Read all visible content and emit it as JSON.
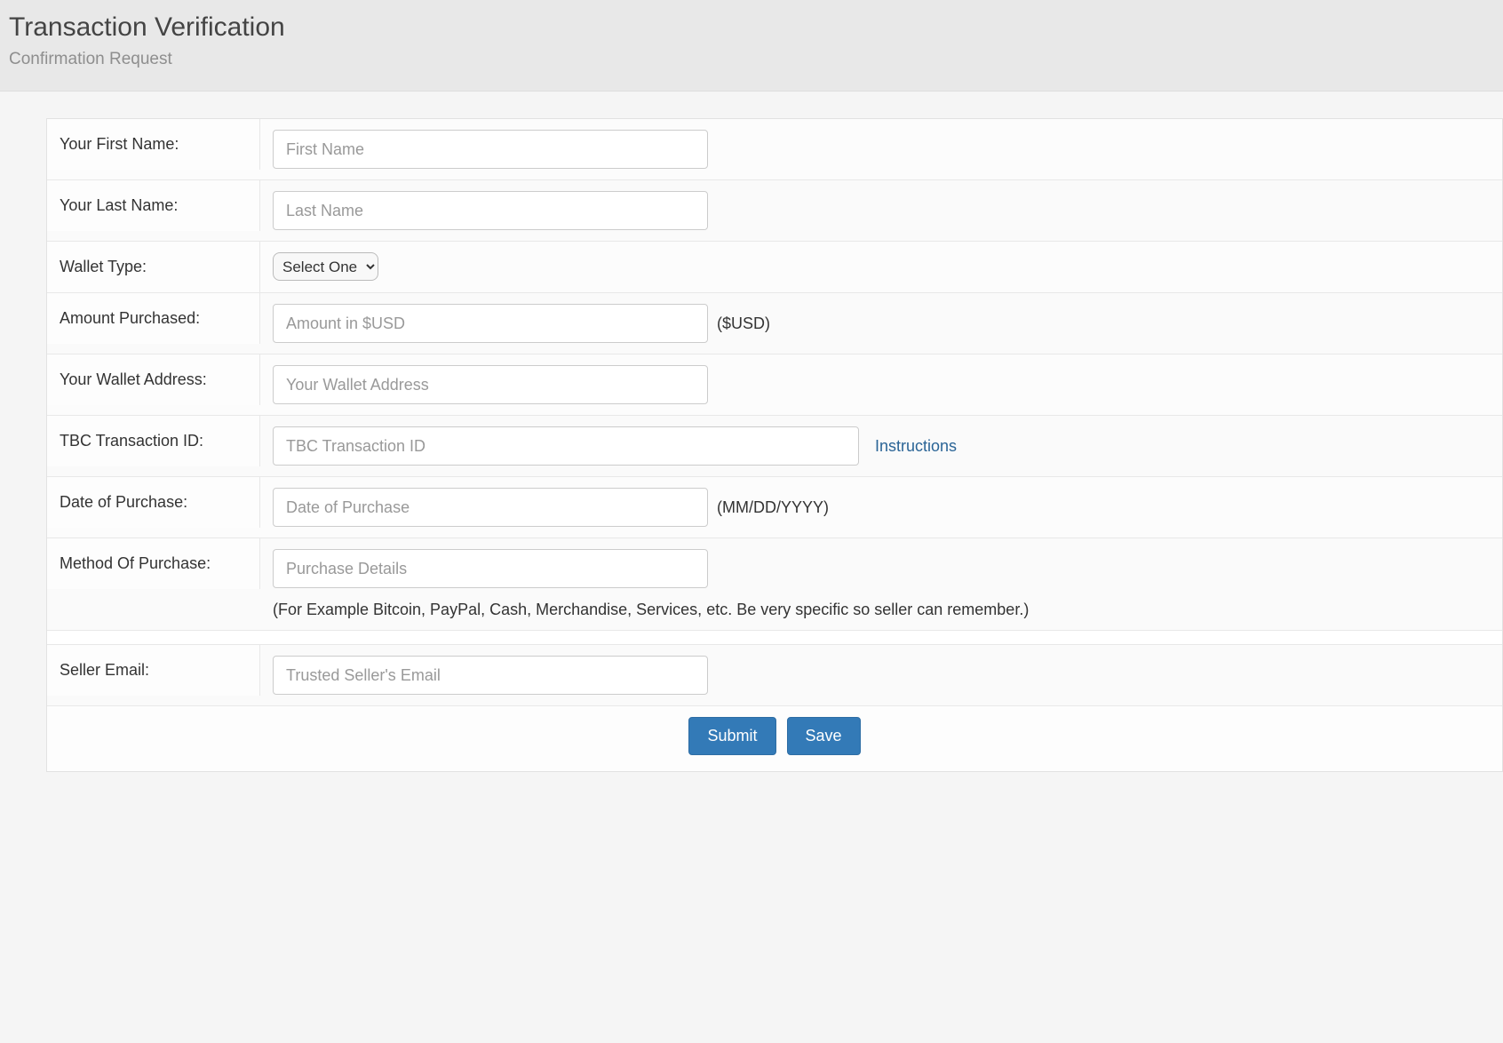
{
  "header": {
    "title": "Transaction Verification",
    "subtitle": "Confirmation Request"
  },
  "form": {
    "first_name": {
      "label": "Your First Name:",
      "placeholder": "First Name",
      "value": ""
    },
    "last_name": {
      "label": "Your Last Name:",
      "placeholder": "Last Name",
      "value": ""
    },
    "wallet_type": {
      "label": "Wallet Type:",
      "selected": "Select One",
      "options": [
        "Select One"
      ]
    },
    "amount_purchased": {
      "label": "Amount Purchased:",
      "placeholder": "Amount in $USD",
      "value": "",
      "suffix": "($USD)"
    },
    "wallet_address": {
      "label": "Your Wallet Address:",
      "placeholder": "Your Wallet Address",
      "value": ""
    },
    "tbc_transaction_id": {
      "label": "TBC Transaction ID:",
      "placeholder": "TBC Transaction ID",
      "value": "",
      "link_text": "Instructions"
    },
    "date_of_purchase": {
      "label": "Date of Purchase:",
      "placeholder": "Date of Purchase",
      "value": "",
      "suffix": "(MM/DD/YYYY)"
    },
    "method_of_purchase": {
      "label": "Method Of Purchase:",
      "placeholder": "Purchase Details",
      "value": "",
      "help": "(For Example Bitcoin, PayPal, Cash, Merchandise, Services, etc. Be very specific so seller can remember.)"
    },
    "seller_email": {
      "label": "Seller Email:",
      "placeholder": "Trusted Seller's Email",
      "value": ""
    }
  },
  "buttons": {
    "submit": "Submit",
    "save": "Save"
  }
}
